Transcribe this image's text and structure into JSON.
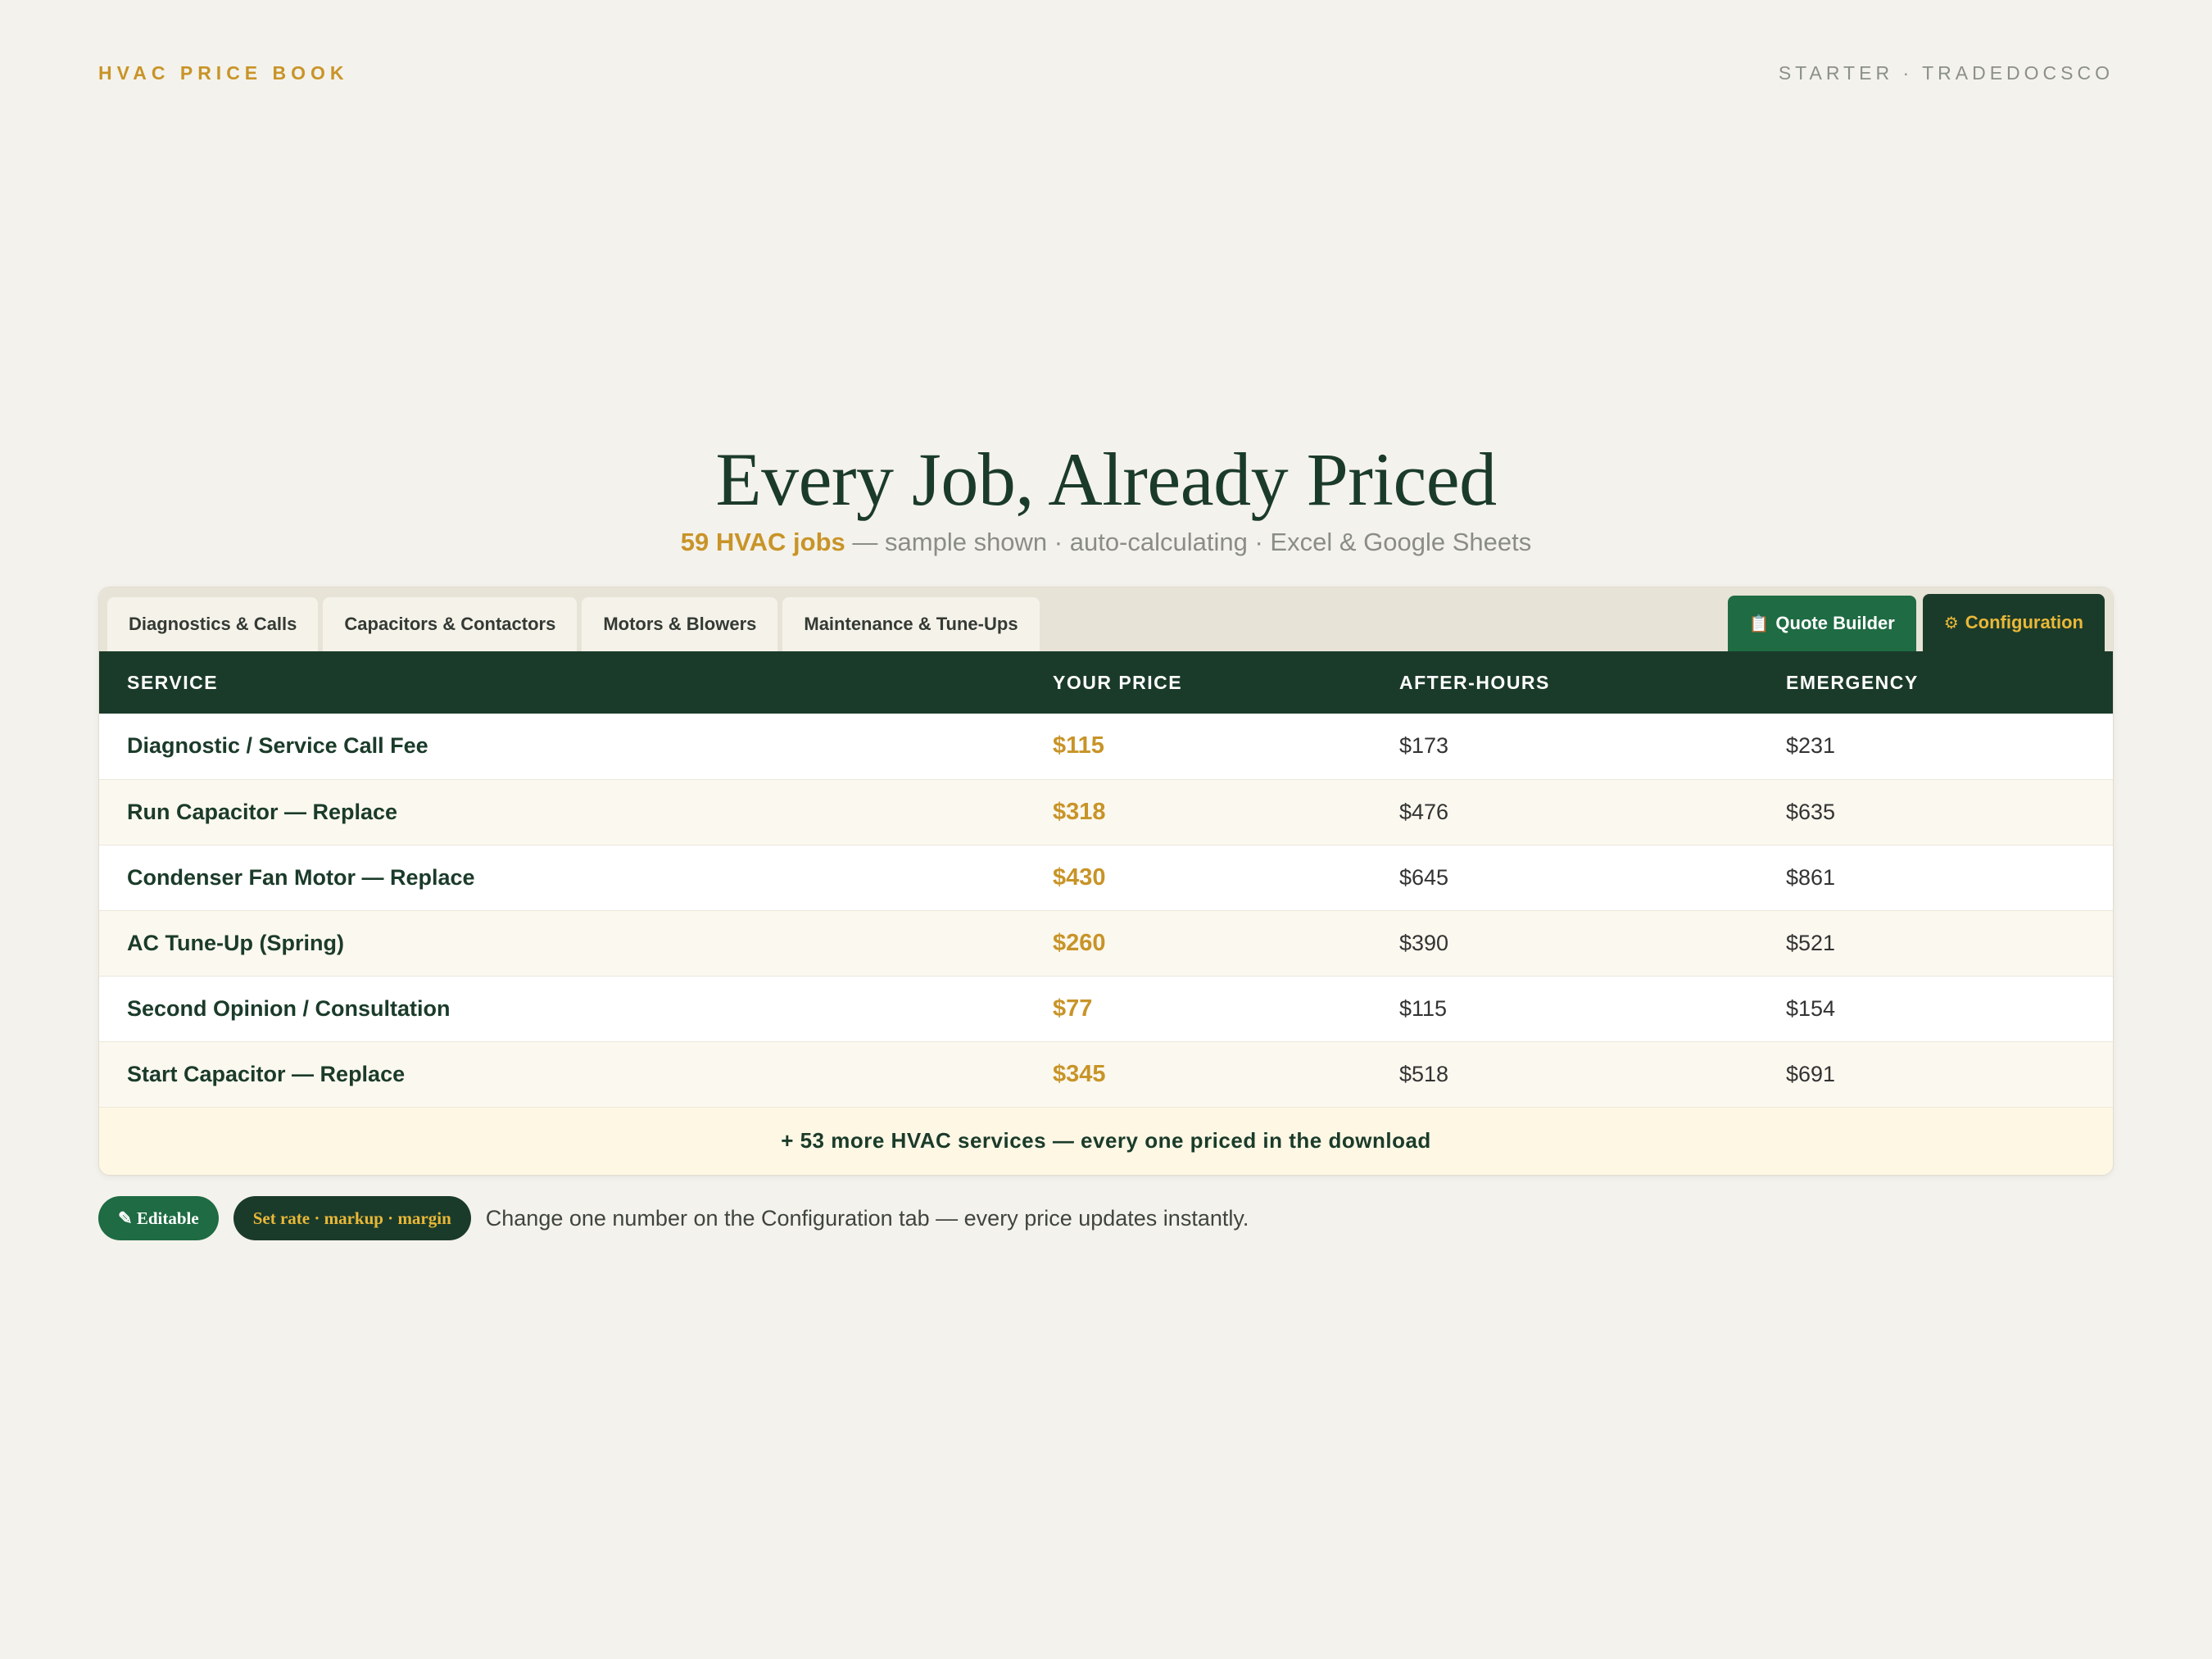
{
  "header": {
    "brand": "HVAC PRICE BOOK",
    "meta": "STARTER · TRADEDOCSCO"
  },
  "hero": {
    "title": "Every Job, Already Priced",
    "count": "59 HVAC jobs",
    "subtitle": "— sample shown · auto-calculating · Excel & Google Sheets"
  },
  "tabs": [
    {
      "label": "Diagnostics & Calls"
    },
    {
      "label": "Capacitors & Contactors"
    },
    {
      "label": "Motors & Blowers"
    },
    {
      "label": "Maintenance & Tune-Ups"
    }
  ],
  "actions": {
    "quote_icon": "📋",
    "quote_label": "Quote Builder",
    "config_icon": "⚙",
    "config_label": "Configuration"
  },
  "table": {
    "headers": {
      "service": "SERVICE",
      "price": "YOUR PRICE",
      "after_hours": "AFTER-HOURS",
      "emergency": "EMERGENCY"
    },
    "rows": [
      {
        "service": "Diagnostic / Service Call Fee",
        "price": "$115",
        "after_hours": "$173",
        "emergency": "$231"
      },
      {
        "service": "Run Capacitor — Replace",
        "price": "$318",
        "after_hours": "$476",
        "emergency": "$635"
      },
      {
        "service": "Condenser Fan Motor — Replace",
        "price": "$430",
        "after_hours": "$645",
        "emergency": "$861"
      },
      {
        "service": "AC Tune-Up (Spring)",
        "price": "$260",
        "after_hours": "$390",
        "emergency": "$521"
      },
      {
        "service": "Second Opinion / Consultation",
        "price": "$77",
        "after_hours": "$115",
        "emergency": "$154"
      },
      {
        "service": "Start Capacitor — Replace",
        "price": "$345",
        "after_hours": "$518",
        "emergency": "$691"
      }
    ],
    "more": "+ 53 more HVAC services — every one priced in the download"
  },
  "footer": {
    "editable_label": "✎ Editable",
    "rate_label": "Set rate · markup · margin",
    "note": "Change one number on the Configuration tab — every price updates instantly."
  },
  "colors": {
    "background": "#f4f2ec",
    "brand_gold": "#c89428",
    "dark_green": "#1b3b2a",
    "accent_green": "#1f6b43"
  }
}
